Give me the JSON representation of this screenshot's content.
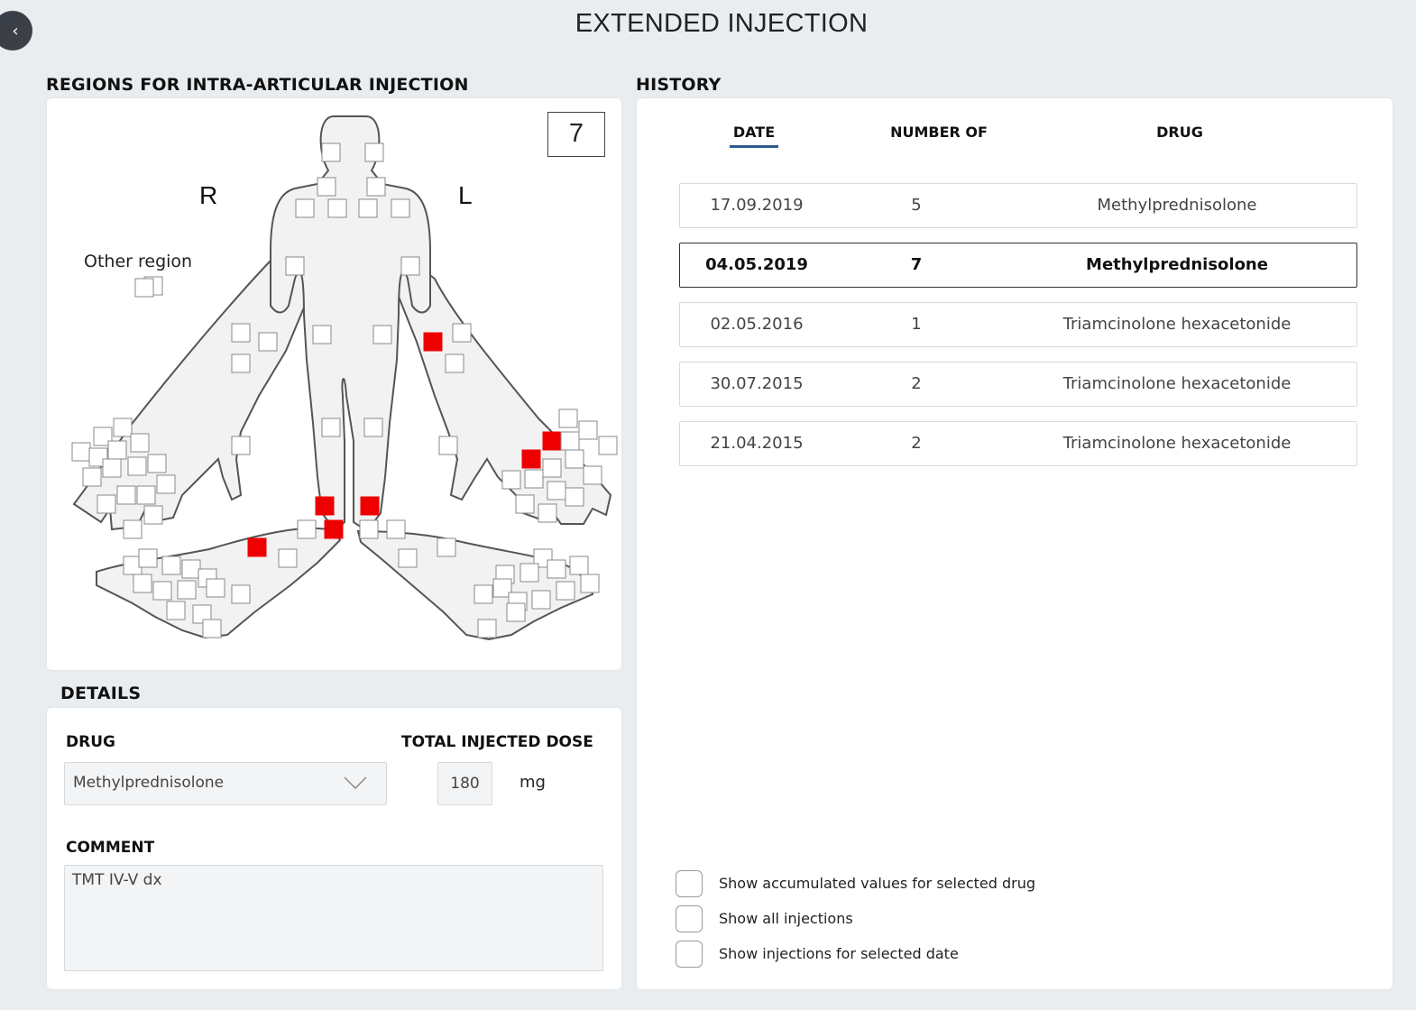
{
  "header": {
    "title": "EXTENDED INJECTION",
    "back_icon": "chevron-left-icon"
  },
  "regions": {
    "section_title": "REGIONS FOR INTRA-ARTICULAR INJECTION",
    "count": "7",
    "right_label": "R",
    "left_label": "L",
    "other_region_label": "Other region",
    "selected_color": "#ee0000"
  },
  "details": {
    "section_title": "DETAILS",
    "drug_label": "DRUG",
    "drug_value": "Methylprednisolone",
    "dose_label": "TOTAL INJECTED DOSE",
    "dose_value": "180",
    "dose_unit": "mg",
    "comment_label": "COMMENT",
    "comment_value": "TMT IV-V dx"
  },
  "history": {
    "section_title": "HISTORY",
    "columns": [
      "DATE",
      "NUMBER OF",
      "DRUG"
    ],
    "sort_accent": "#2a5a8a",
    "rows": [
      {
        "date": "17.09.2019",
        "number": "5",
        "drug": "Methylprednisolone",
        "selected": false
      },
      {
        "date": "04.05.2019",
        "number": "7",
        "drug": "Methylprednisolone",
        "selected": true
      },
      {
        "date": "02.05.2016",
        "number": "1",
        "drug": "Triamcinolone hexacetonide",
        "selected": false
      },
      {
        "date": "30.07.2015",
        "number": "2",
        "drug": "Triamcinolone hexacetonide",
        "selected": false
      },
      {
        "date": "21.04.2015",
        "number": "2",
        "drug": "Triamcinolone hexacetonide",
        "selected": false
      }
    ],
    "options": [
      "Show accumulated values for selected drug",
      "Show all injections",
      "Show injections for selected date"
    ]
  }
}
